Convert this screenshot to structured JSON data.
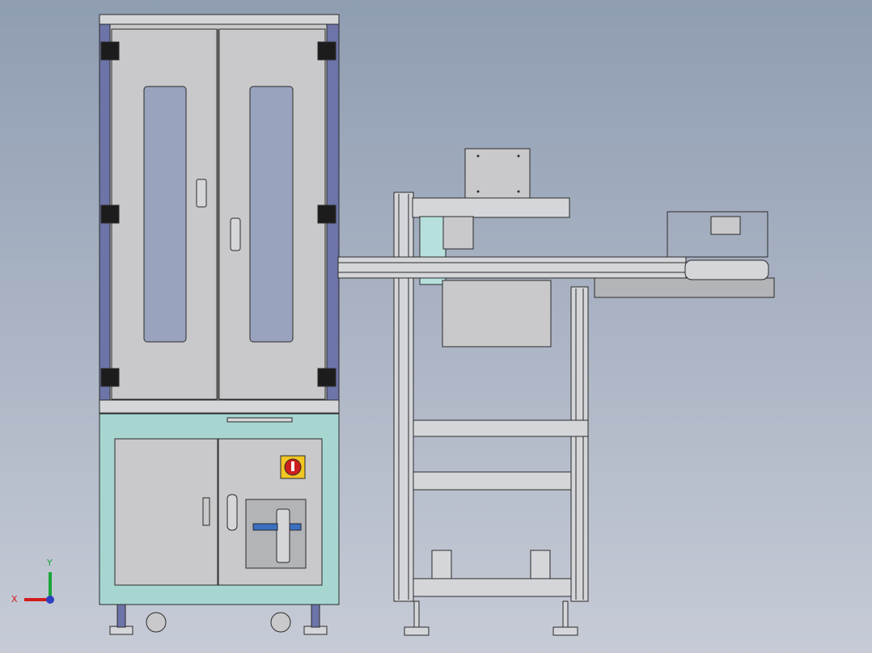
{
  "viewport": {
    "background_top": "#8f9db2",
    "background_bottom": "#c6cbd6"
  },
  "colors": {
    "line": "#2b2b2b",
    "panel": "#c9c9cb",
    "panel_dark": "#b3b4b8",
    "glass": "#9aa3bd",
    "frame_blue": "#6c74a8",
    "aluminium": "#d4d6da",
    "teal_base": "#a7d6d1",
    "hinge": "#1c1c1c",
    "switch_red": "#cc1f1f",
    "switch_yellow": "#f2c623",
    "blue_part": "#3a6fc2",
    "mint_part": "#b7e0dc"
  },
  "triad": {
    "x_label": "X",
    "y_label": "Y",
    "x_color": "#d21b1b",
    "y_color": "#1aa53a",
    "z_color": "#2f3fbf",
    "icon": "coordinate-triad-icon"
  }
}
